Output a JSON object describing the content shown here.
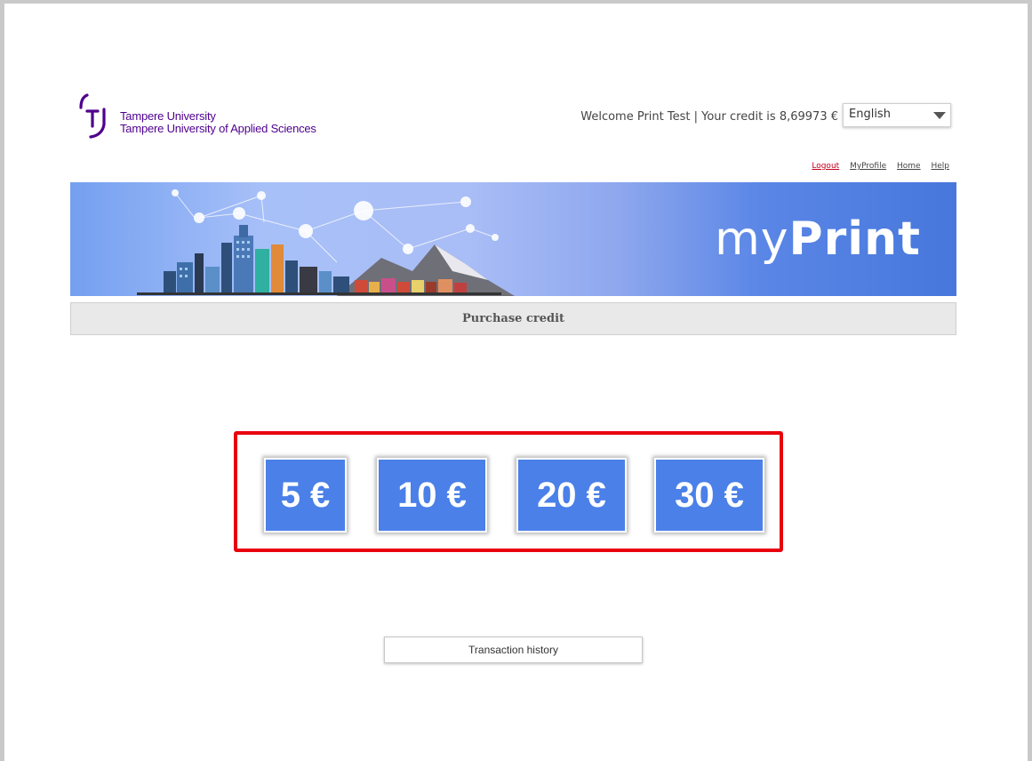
{
  "logo": {
    "line1": "Tampere University",
    "line2": "Tampere University of Applied Sciences",
    "color": "#4e008e"
  },
  "header": {
    "welcome": "Welcome Print Test | Your credit is 8,69973 €",
    "language": {
      "selected": "English"
    }
  },
  "links": {
    "logout": "Logout",
    "myprofile": "MyProfile",
    "home": "Home",
    "help": "Help"
  },
  "banner": {
    "brand_light": "my",
    "brand_bold": "Print"
  },
  "section": {
    "title": "Purchase credit"
  },
  "amounts": [
    "5 €",
    "10 €",
    "20 €",
    "30 €"
  ],
  "history_button": "Transaction history",
  "colors": {
    "accent": "#4a80e8",
    "highlight_border": "#e8000e",
    "logout": "#c0001c"
  }
}
